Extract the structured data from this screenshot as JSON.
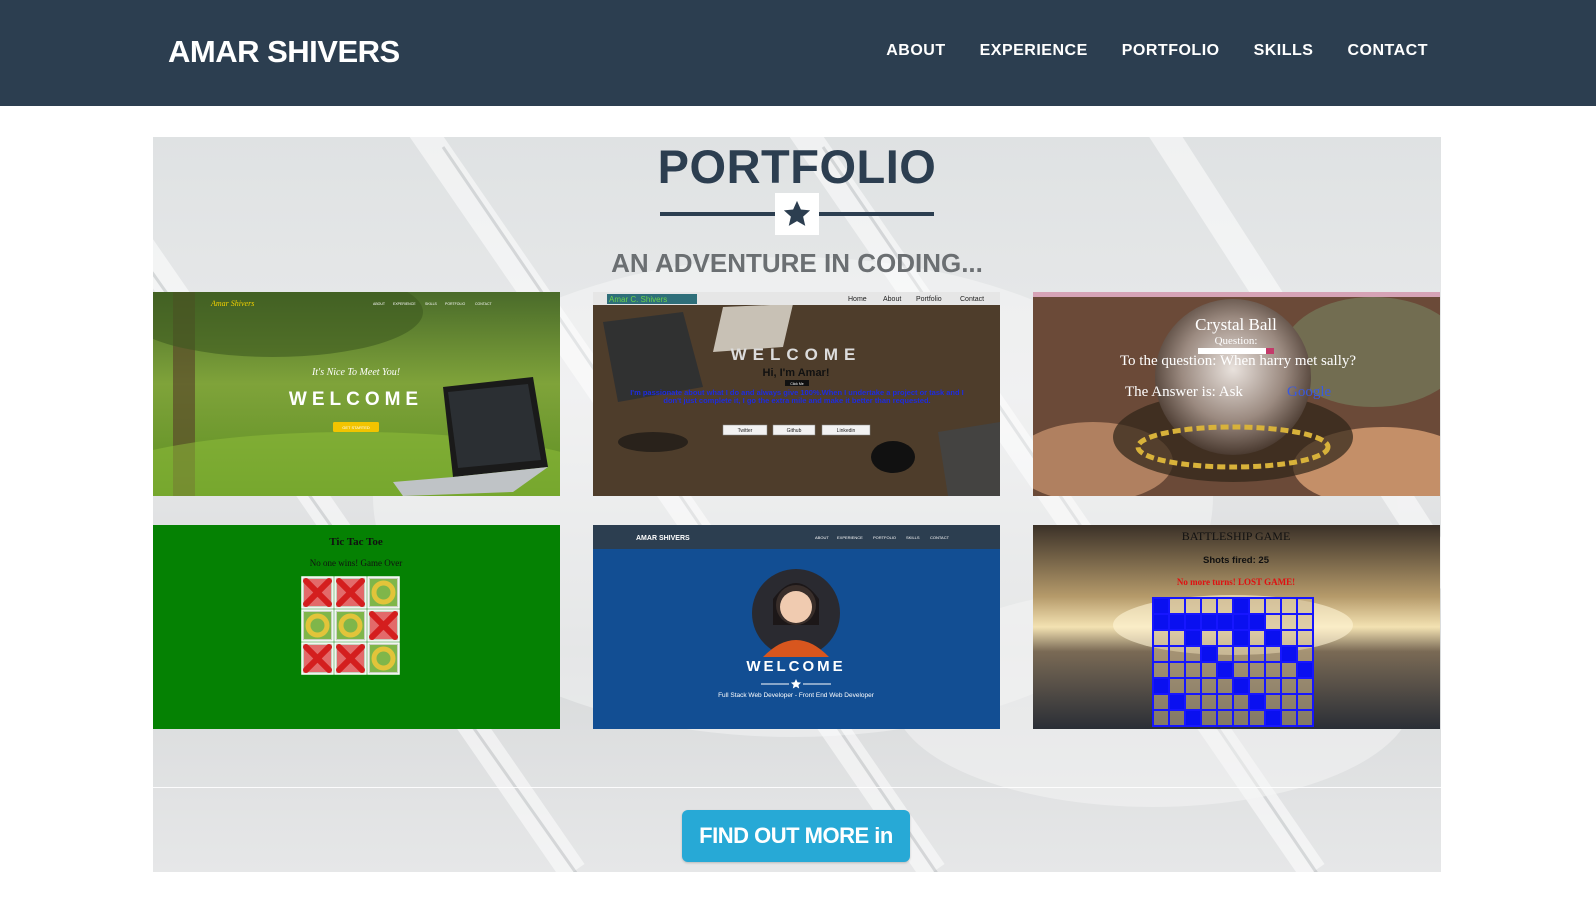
{
  "navbar": {
    "brand": "AMAR SHIVERS",
    "links": [
      "ABOUT",
      "EXPERIENCE",
      "PORTFOLIO",
      "SKILLS",
      "CONTACT"
    ]
  },
  "portfolio": {
    "title": "PORTFOLIO",
    "subtitle": "AN ADVENTURE IN CODING...",
    "button_label": "FIND OUT MORE in",
    "items": [
      {
        "brand": "Amar Shivers",
        "nav": [
          "ABOUT",
          "EXPERIENCE",
          "SKILLS",
          "PORTFOLIO",
          "CONTACT"
        ],
        "tagline": "It's Nice To Meet You!",
        "heading": "WELCOME",
        "button": "GET STARTED"
      },
      {
        "brand": "Amar C. Shivers",
        "nav": [
          "Home",
          "About",
          "Portfolio",
          "Contact"
        ],
        "heading": "WELCOME",
        "greeting": "Hi, I'm Amar!",
        "small_button": "Click Me",
        "body": "I'm passionate about what I do and always give 100%.When I undertake a project or task and I don't just complete it, I go the extra mile and make it better than requested.",
        "buttons": [
          "Twitter",
          "Github",
          "Linkedin"
        ]
      },
      {
        "title": "Crystal Ball",
        "question_label": "Question:",
        "question": "To the question: When harry met sally?",
        "answer_prefix": "The Answer is: Ask",
        "answer_link": "Google"
      },
      {
        "title": "Tic Tac Toe",
        "status": "No one wins! Game Over",
        "board": [
          "X",
          "X",
          "O",
          "O",
          "O",
          "X",
          "X",
          "X",
          "O"
        ]
      },
      {
        "brand": "AMAR SHIVERS",
        "nav": [
          "ABOUT",
          "EXPERIENCE",
          "PORTFOLIO",
          "SKILLS",
          "CONTACT"
        ],
        "heading": "WELCOME",
        "tagline": "Full Stack Web Developer - Front End Web Developer"
      },
      {
        "title": "BATTLESHIP GAME",
        "shots": "Shots fired: 25",
        "status": "No more turns! LOST GAME!"
      }
    ]
  },
  "colors": {
    "navbar": "#2c3e50",
    "button": "#27a9d6",
    "tile_green": "#058103",
    "tile_blue": "#124e93"
  }
}
